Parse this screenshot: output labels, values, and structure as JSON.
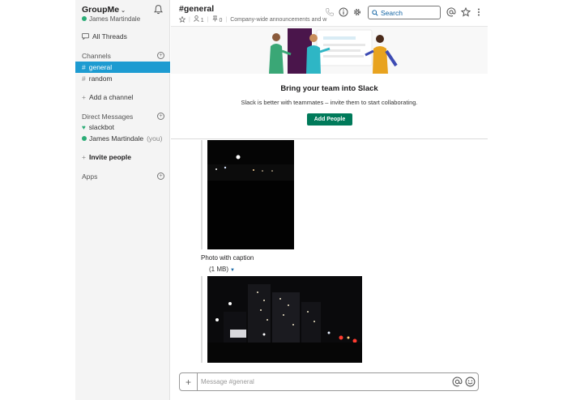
{
  "sidebar": {
    "workspace_name": "GroupMe",
    "workspace_caret": "⌄",
    "user_name": "James Martindale",
    "all_threads": "All Threads",
    "channels_header": "Channels",
    "channels": [
      {
        "prefix": "#",
        "name": "general",
        "active": true
      },
      {
        "prefix": "#",
        "name": "random",
        "active": false
      }
    ],
    "add_channel": "Add a channel",
    "dm_header": "Direct Messages",
    "dms": [
      {
        "name": "slackbot"
      },
      {
        "name": "James Martindale",
        "suffix": "(you)"
      }
    ],
    "invite_people": "Invite people",
    "apps_header": "Apps"
  },
  "header": {
    "channel_name": "#general",
    "members_count": "1",
    "pins_count": "0",
    "topic": "Company-wide announcements and w",
    "search_label": "Search"
  },
  "banner": {
    "title": "Bring your team into Slack",
    "subtitle": "Slack is better with teammates – invite them to start collaborating.",
    "button_label": "Add People"
  },
  "messages": {
    "caption": "Photo with caption",
    "file_size": "(1 MB)"
  },
  "composer": {
    "placeholder": "Message #general"
  },
  "colors": {
    "active_channel": "#1d9bd1",
    "presence": "#2bac76",
    "button": "#007a5a",
    "link": "#1264a3"
  },
  "icons": [
    "bell-icon",
    "threads-icon",
    "add-circle-icon",
    "heart-icon",
    "star-icon",
    "person-icon",
    "pin-icon",
    "phone-icon",
    "info-icon",
    "gear-icon",
    "search-icon",
    "at-icon",
    "more-icon",
    "emoji-icon"
  ]
}
